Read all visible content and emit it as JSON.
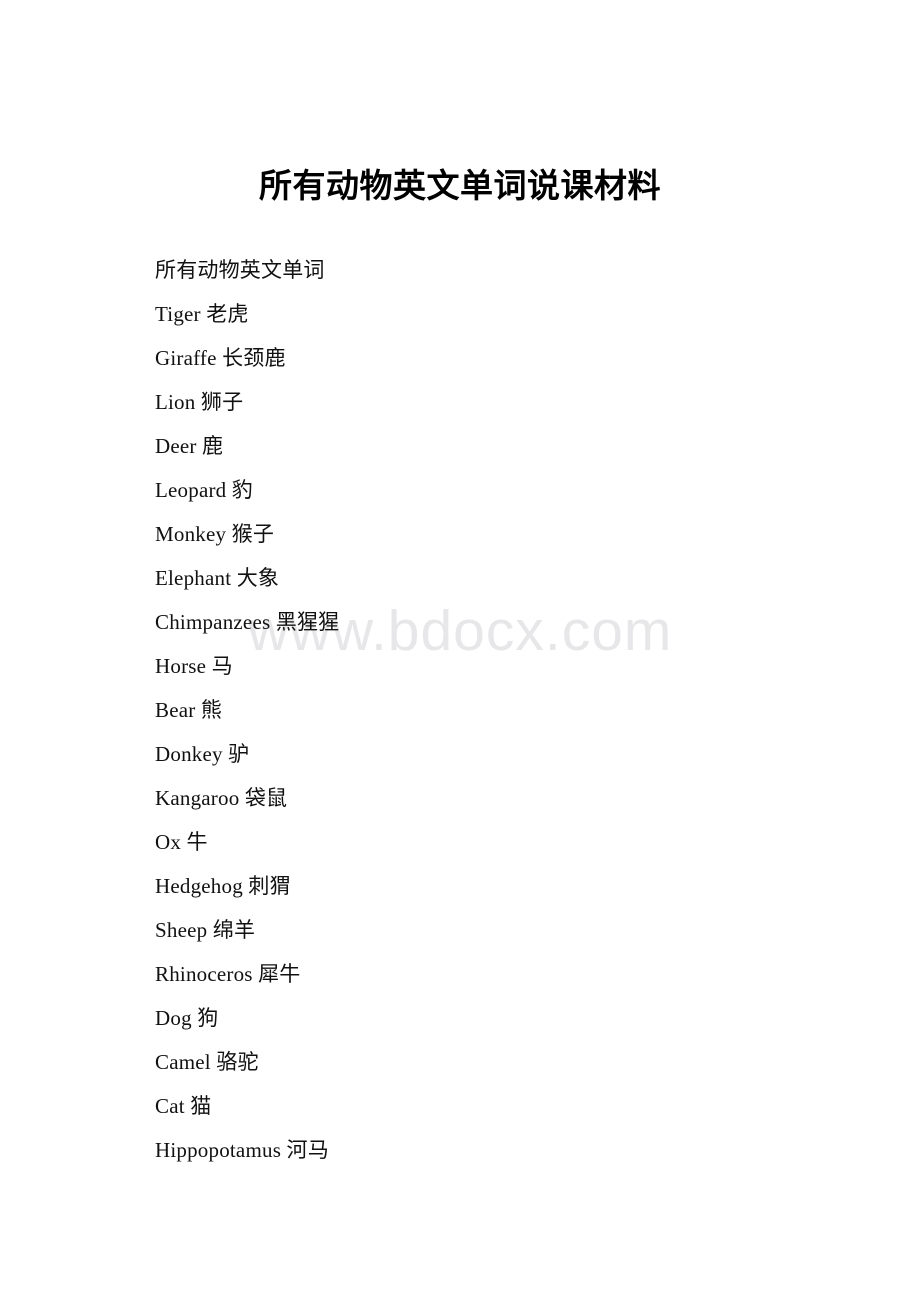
{
  "document": {
    "title": "所有动物英文单词说课材料",
    "watermark": "www.bdocx.com",
    "heading_line": "所有动物英文单词",
    "lines": [
      "所有动物英文单词",
      "Tiger 老虎",
      "Giraffe 长颈鹿",
      "Lion 狮子",
      "Deer 鹿",
      "Leopard 豹",
      "Monkey 猴子",
      "Elephant 大象",
      "Chimpanzees 黑猩猩",
      "Horse 马",
      "Bear 熊",
      "Donkey 驴",
      "Kangaroo 袋鼠",
      "Ox 牛",
      "Hedgehog 刺猬",
      "Sheep 绵羊",
      "Rhinoceros 犀牛",
      "Dog 狗",
      "Camel 骆驼",
      "Cat 猫",
      "Hippopotamus 河马"
    ]
  },
  "colors": {
    "page_background": "#ffffff",
    "text": "#111111",
    "title_text": "#000000",
    "watermark": "#e7e7e9"
  }
}
